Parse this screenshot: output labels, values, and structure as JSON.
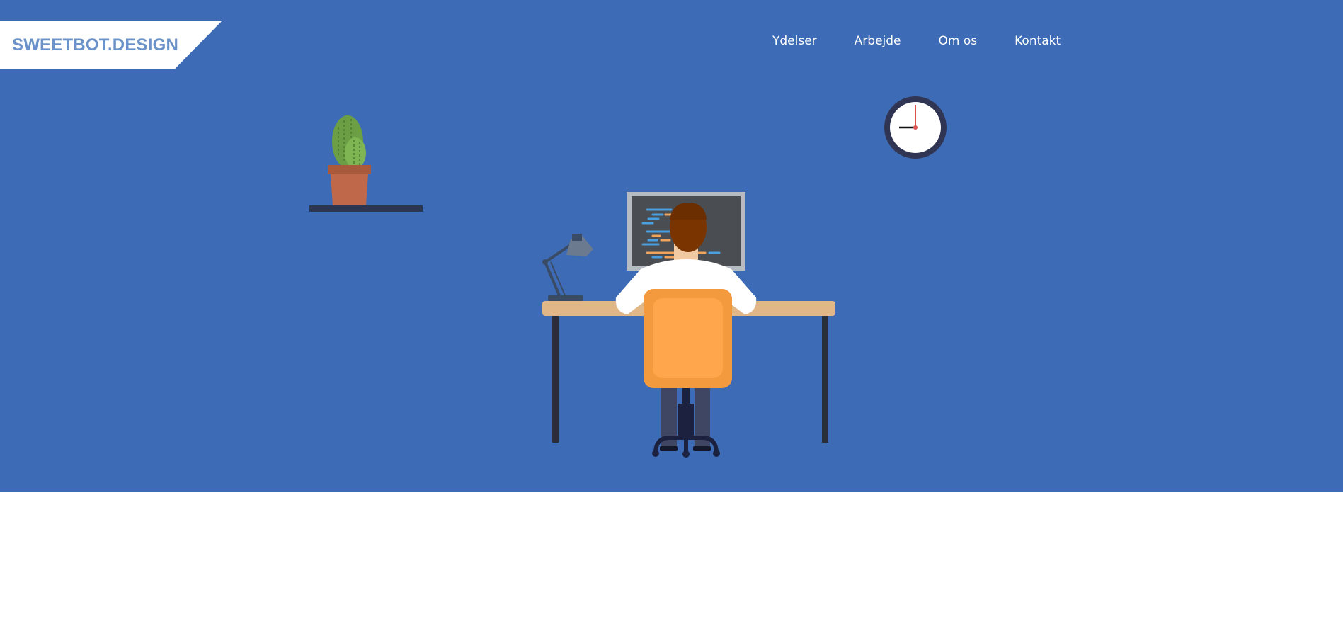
{
  "header": {
    "logo_text": "SWEETBOT.DESIGN",
    "nav": [
      {
        "label": "Ydelser"
      },
      {
        "label": "Arbejde"
      },
      {
        "label": "Om os"
      },
      {
        "label": "Kontakt"
      }
    ]
  },
  "colors": {
    "hero_background": "#3e6bb5",
    "logo_text": "#6b93c9",
    "chair": "#f29a3d",
    "desk_top": "#e2b787",
    "shelf": "#2c3650"
  },
  "illustration": {
    "icons": [
      "cactus-plant-icon",
      "wall-clock-icon",
      "desk-lamp-icon",
      "monitor-icon",
      "developer-figure-icon",
      "office-chair-icon",
      "desk-icon"
    ]
  }
}
